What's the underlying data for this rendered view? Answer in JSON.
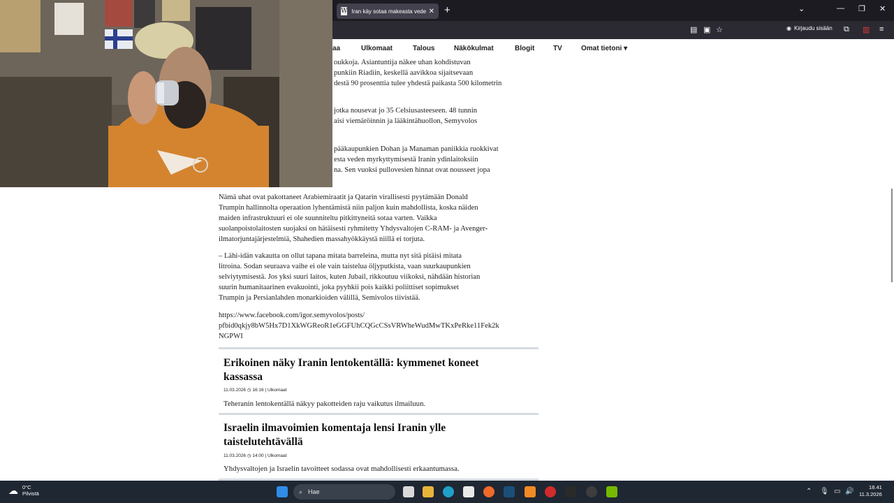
{
  "browser": {
    "tab_title": "Iran käy sotaa makeasta vedestä",
    "tab_favicon": "W",
    "new_tab": "+",
    "signin_label": "Kirjaudu sisään",
    "controls": {
      "chevron": "⌄",
      "minimize": "—",
      "maximize": "❐",
      "close": "✕"
    }
  },
  "site_nav": {
    "items": [
      "aa",
      "Ulkomaat",
      "Talous",
      "Näkökulmat",
      "Blogit",
      "TV",
      "Omat tietoni ▾"
    ]
  },
  "article": {
    "partial_lines": [
      "vet lounaasta kaupunkien loukkoja. Asiantuntija nakee uhan kohdistuvan",
      "oukkoja. Asiantuntija näkee uhan kohdistuvan",
      "punkiin Riadiin, keskellä aavikkoa sijaitsevaan",
      "destä 90 prosenttia tulee yhdestä paikasta 500 kilometrin",
      "jotka nousevat jo 35 Celsiusasteeseen. 48 tunnin",
      "aisi viemäröinnin ja lääkintähuollon, Semyvolos",
      "pääkaupunkien Dohan ja Manaman paniikkia ruokkivat",
      "esta veden myrkyttymisestä Iranin ydinlaitoksiin",
      "na. Sen vuoksi pullovesien hinnat ovat nousseet jopa"
    ],
    "paragraph1": [
      "Nämä uhat ovat pakottaneet Arabiemiraatit ja Qatarin virallisesti pyytämään Donald",
      "Trumpin hallinnolta operaation lyhentämistä niin paljon kuin mahdollista, koska näiden",
      "maiden infrastruktuuri ei ole suunniteltu pitkittyneitä sotaa varten. Vaikka",
      "suolanpoistolaitosten suojaksi on hätäisesti ryhmitetty Yhdysvaltojen C-RAM- ja Avenger-",
      "ilmatorjuntajärjestelmiä, Shahedien massahyökkäystä niillä ei torjuta."
    ],
    "paragraph2": [
      "– Lähi-idän vakautta on ollut tapana mitata barreleina, mutta nyt sitä pitäisi mitata",
      "litroina. Sodan seuraava vaihe ei ole vain taistelua öljyputkista, vaan suurkaupunkien",
      "selviytymisestä. Jos yksi suuri laitos, kuten Jubail, rikkoutuu viikoksi, nähdään historian",
      "suurin humanitaarinen evakuointi, joka pyyhkii pois kaikki poliittiset sopimukset",
      "Trumpin ja Persianlahden monarkioiden välillä, Semivolos tiivistää."
    ],
    "link_lines": [
      "https://www.facebook.com/igor.semyvolos/posts/",
      "pfbid0qkjy8bW5Hx7D1XkWGReoR1eGGFUhCQGcCSsVRWheWudMwTKxPeRke11Fek2k",
      "NGPWI"
    ]
  },
  "cards": [
    {
      "title_lines": [
        "Erikoinen näky Iranin lentokentällä: kymmenet koneet",
        "kassassa"
      ],
      "date": "11.03.2026",
      "time": "16:16",
      "category": "Ulkomaat",
      "lead": "Teheranin lentokentällä näkyy pakotteiden raju vaikutus ilmailuun."
    },
    {
      "title_lines": [
        "Israelin ilmavoimien komentaja lensi Iranin ylle",
        "taistelutehtävällä"
      ],
      "date": "11.03.2026",
      "time": "14:00",
      "category": "Ulkomaat",
      "lead": "Yhdysvaltojen ja Israelin tavoitteet sodassa ovat mahdollisesti erkaantumassa."
    }
  ],
  "taskbar": {
    "weather_temp": "0°C",
    "weather_desc": "Pilvistä",
    "search_label": "Hae",
    "time": "18.41",
    "date": "11.3.2026"
  },
  "colors": {
    "tabbar": "#1c1b22",
    "navbar": "#2b2a33",
    "taskbar": "#1f2733",
    "divider": "#d6dbe2",
    "shirt": "#d4842f"
  }
}
